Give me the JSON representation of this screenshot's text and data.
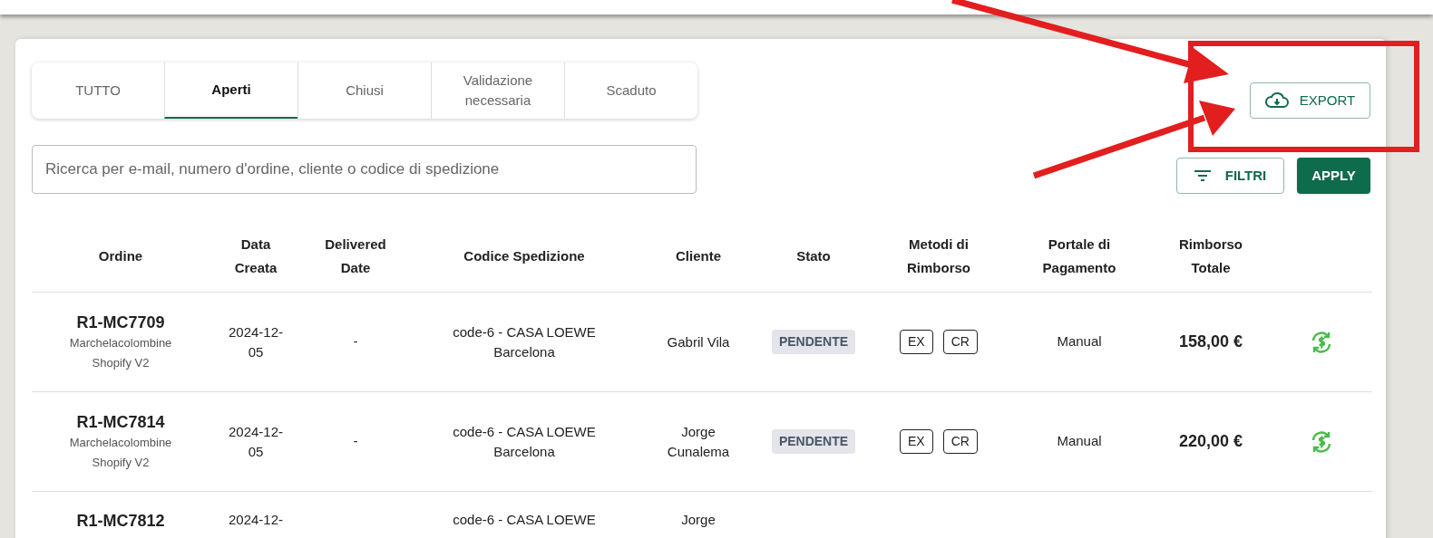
{
  "tabs": [
    {
      "label": "TUTTO",
      "selected": false
    },
    {
      "label": "Aperti",
      "selected": true
    },
    {
      "label": "Chiusi",
      "selected": false
    },
    {
      "label": "Validazione necessaria",
      "selected": false
    },
    {
      "label": "Scaduto",
      "selected": false
    }
  ],
  "search": {
    "placeholder": "Ricerca per e-mail, numero d'ordine, cliente o codice di spedizione"
  },
  "buttons": {
    "export": "EXPORT",
    "filters": "FILTRI",
    "apply": "APPLY"
  },
  "table": {
    "columns": [
      "Ordine",
      "Data Creata",
      "Delivered Date",
      "Codice Spedizione",
      "Cliente",
      "Stato",
      "Metodi di Rimborso",
      "Portale di Pagamento",
      "Rimborso Totale"
    ],
    "rows": [
      {
        "order": "R1-MC7709",
        "store": "Marchelacolombine Shopify V2",
        "created": "2024-12-05",
        "delivered": "-",
        "shipping_code": "code-6 - CASA LOEWE Barcelona",
        "customer": "Gabril Vila",
        "status": "PENDENTE",
        "refund_methods": [
          "EX",
          "CR"
        ],
        "gateway": "Manual",
        "total": "158,00 €"
      },
      {
        "order": "R1-MC7814",
        "store": "Marchelacolombine Shopify V2",
        "created": "2024-12-05",
        "delivered": "-",
        "shipping_code": "code-6 - CASA LOEWE Barcelona",
        "customer": "Jorge Cunalema",
        "status": "PENDENTE",
        "refund_methods": [
          "EX",
          "CR"
        ],
        "gateway": "Manual",
        "total": "220,00 €"
      },
      {
        "order": "R1-MC7812",
        "created": "2024-12-",
        "shipping_code": "code-6 - CASA LOEWE",
        "customer": "Jorge"
      }
    ]
  }
}
